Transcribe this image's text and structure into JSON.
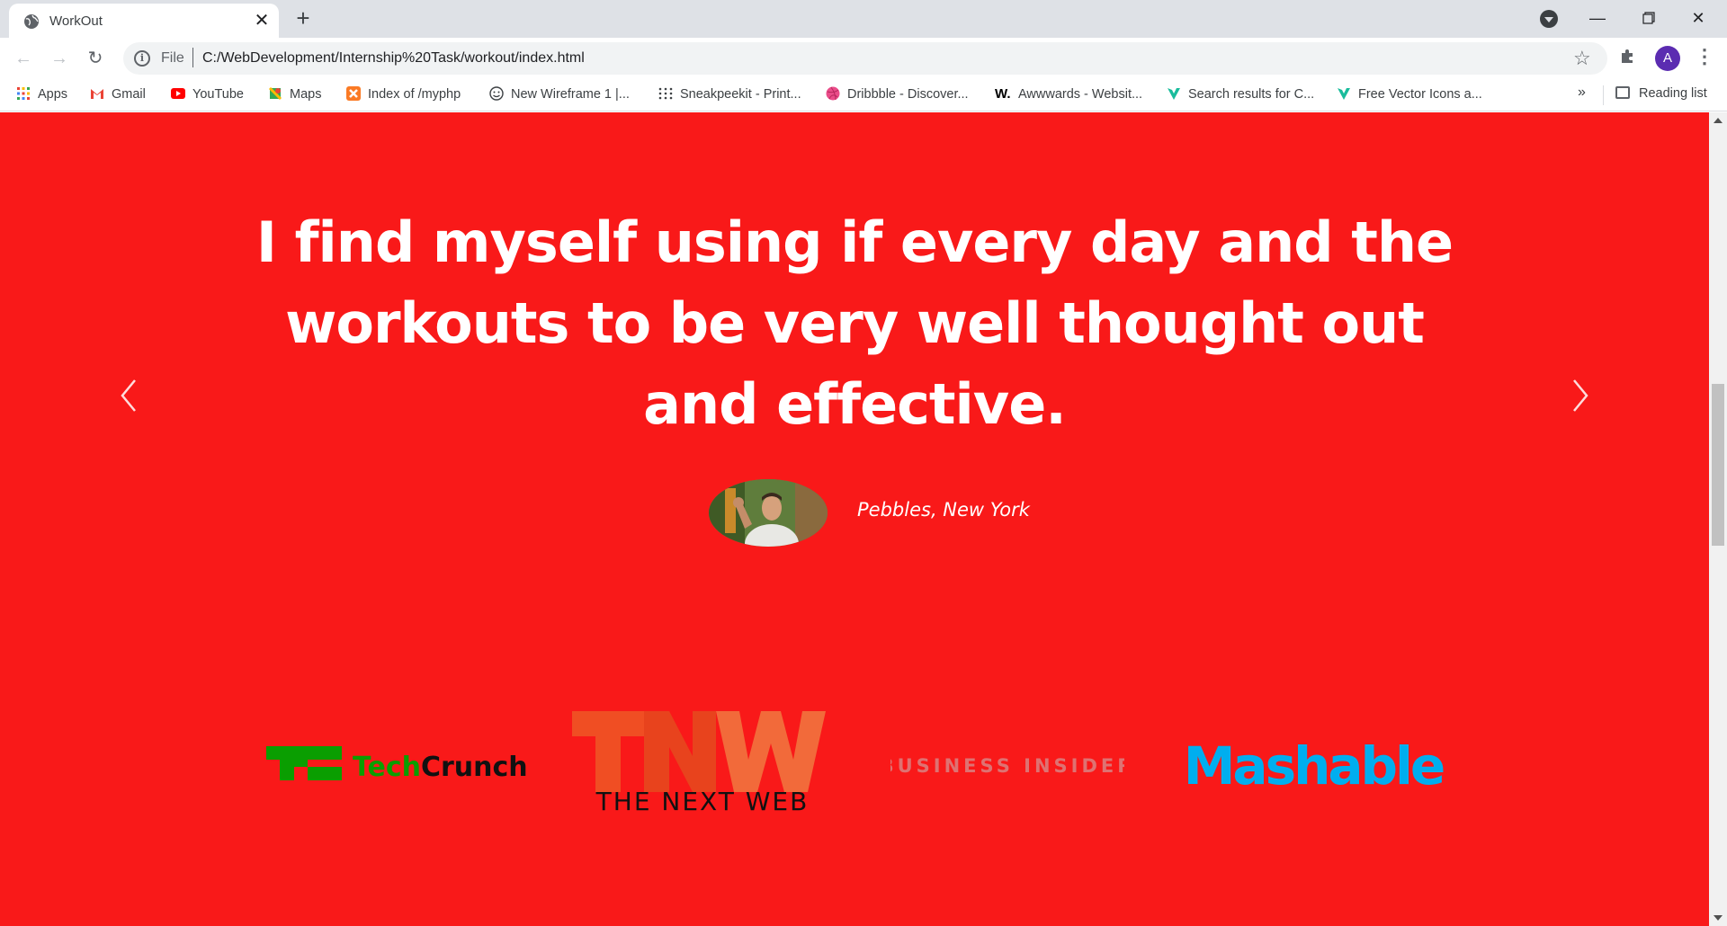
{
  "browser": {
    "tab_title": "WorkOut",
    "new_tab_label": "+",
    "url_scheme": "File",
    "url": "C:/WebDevelopment/Internship%20Task/workout/index.html",
    "profile_initial": "A",
    "icons": [
      "globe-icon",
      "close-icon",
      "back-icon",
      "forward-icon",
      "reload-icon",
      "info-icon",
      "star-icon",
      "extensions-icon",
      "menu-icon"
    ]
  },
  "bookmarks": {
    "items": [
      {
        "label": "Apps",
        "icon": "apps-grid-icon"
      },
      {
        "label": "Gmail",
        "icon": "gmail-icon"
      },
      {
        "label": "YouTube",
        "icon": "youtube-icon"
      },
      {
        "label": "Maps",
        "icon": "maps-icon"
      },
      {
        "label": "Index of /myphp",
        "icon": "xampp-icon"
      },
      {
        "label": "New Wireframe 1 |...",
        "icon": "smiley-icon"
      },
      {
        "label": "Sneakpeekit - Print...",
        "icon": "dots-grid-icon"
      },
      {
        "label": "Dribbble - Discover...",
        "icon": "dribbble-icon"
      },
      {
        "label": "Awwwards - Websit...",
        "icon": "awwwards-icon"
      },
      {
        "label": "Search results for C...",
        "icon": "vector-icon"
      },
      {
        "label": "Free Vector Icons a...",
        "icon": "vector-icon"
      }
    ],
    "overflow_label": "»",
    "reading_list_label": "Reading list"
  },
  "testimonial": {
    "quote": "I find myself using if every day and the workouts to be very well thought out and effective.",
    "author": "Pebbles, New York"
  },
  "press_logos": {
    "techcrunch": "TechCrunch",
    "tnw": "TNW",
    "tnw_sub": "THE NEXT WEB",
    "business_insider": "BUSINESS INSIDER",
    "mashable": "Mashable"
  },
  "colors": {
    "page_background": "#f91919",
    "techcrunch_green": "#0a9e01",
    "tnw_orange": "#f04e23",
    "mashable_blue": "#00aeef",
    "business_insider_gray": "#cccccc"
  }
}
